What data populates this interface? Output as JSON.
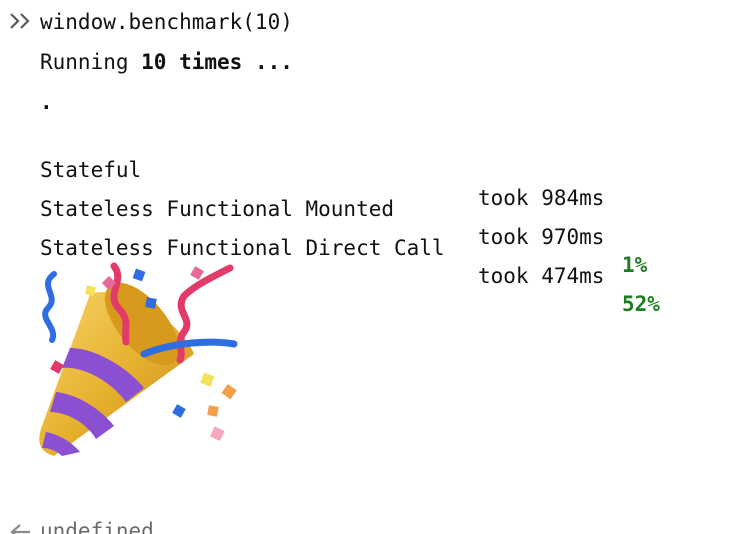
{
  "console": {
    "input_command": "window.benchmark(10)",
    "running_prefix": "Running ",
    "running_count": "10",
    "running_suffix": " times ...",
    "progress_dot": ".",
    "results": [
      {
        "name": "Stateful",
        "time": "took 984ms",
        "diff": ""
      },
      {
        "name": "Stateless Functional Mounted",
        "time": "took 970ms",
        "diff": "1%"
      },
      {
        "name": "Stateless Functional Direct Call",
        "time": "took 474ms",
        "diff": "52%"
      }
    ],
    "emoji": "party-popper",
    "return_value": "undefined"
  },
  "colors": {
    "text": "#111111",
    "percent_green": "#1e7d21",
    "prompt_icon": "#5a5a5a"
  }
}
